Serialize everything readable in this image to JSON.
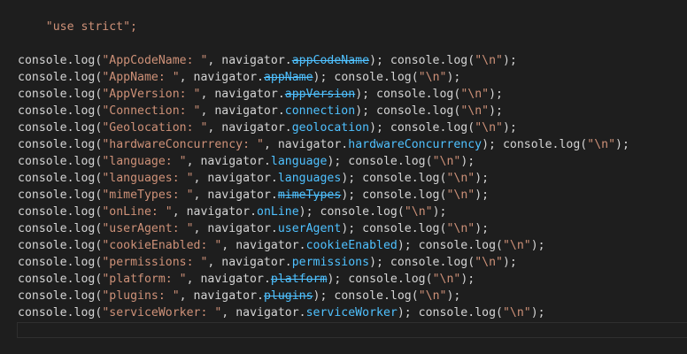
{
  "editor": {
    "theme_colors": {
      "background": "#1e1e1e",
      "string": "#ce9178",
      "identifier": "#d4d4d4",
      "property": "#4fc1ff"
    },
    "directive": "\"use strict\";",
    "lines": [
      {
        "obj": "console",
        "dot1": ".",
        "fn": "log",
        "open": "(",
        "label": "\"AppCodeName: \"",
        "comma": ", ",
        "target": "navigator",
        "dot2": ".",
        "prop": "appCodeName",
        "deprecated": true,
        "close": "); ",
        "obj2": "console",
        "dot3": ".",
        "fn2": "log",
        "open2": "(",
        "nl": "\"\\n\"",
        "close2": ");"
      },
      {
        "obj": "console",
        "dot1": ".",
        "fn": "log",
        "open": "(",
        "label": "\"AppName: \"",
        "comma": ", ",
        "target": "navigator",
        "dot2": ".",
        "prop": "appName",
        "deprecated": true,
        "close": "); ",
        "obj2": "console",
        "dot3": ".",
        "fn2": "log",
        "open2": "(",
        "nl": "\"\\n\"",
        "close2": ");"
      },
      {
        "obj": "console",
        "dot1": ".",
        "fn": "log",
        "open": "(",
        "label": "\"AppVersion: \"",
        "comma": ", ",
        "target": "navigator",
        "dot2": ".",
        "prop": "appVersion",
        "deprecated": true,
        "close": "); ",
        "obj2": "console",
        "dot3": ".",
        "fn2": "log",
        "open2": "(",
        "nl": "\"\\n\"",
        "close2": ");"
      },
      {
        "obj": "console",
        "dot1": ".",
        "fn": "log",
        "open": "(",
        "label": "\"Connection: \"",
        "comma": ", ",
        "target": "navigator",
        "dot2": ".",
        "prop": "connection",
        "deprecated": false,
        "close": "); ",
        "obj2": "console",
        "dot3": ".",
        "fn2": "log",
        "open2": "(",
        "nl": "\"\\n\"",
        "close2": ");"
      },
      {
        "obj": "console",
        "dot1": ".",
        "fn": "log",
        "open": "(",
        "label": "\"Geolocation: \"",
        "comma": ", ",
        "target": "navigator",
        "dot2": ".",
        "prop": "geolocation",
        "deprecated": false,
        "close": "); ",
        "obj2": "console",
        "dot3": ".",
        "fn2": "log",
        "open2": "(",
        "nl": "\"\\n\"",
        "close2": ");"
      },
      {
        "obj": "console",
        "dot1": ".",
        "fn": "log",
        "open": "(",
        "label": "\"hardwareConcurrency: \"",
        "comma": ", ",
        "target": "navigator",
        "dot2": ".",
        "prop": "hardwareConcurrency",
        "deprecated": false,
        "close": "); ",
        "obj2": "console",
        "dot3": ".",
        "fn2": "log",
        "open2": "(",
        "nl": "\"\\n\"",
        "close2": ");"
      },
      {
        "obj": "console",
        "dot1": ".",
        "fn": "log",
        "open": "(",
        "label": "\"language: \"",
        "comma": ", ",
        "target": "navigator",
        "dot2": ".",
        "prop": "language",
        "deprecated": false,
        "close": "); ",
        "obj2": "console",
        "dot3": ".",
        "fn2": "log",
        "open2": "(",
        "nl": "\"\\n\"",
        "close2": ");"
      },
      {
        "obj": "console",
        "dot1": ".",
        "fn": "log",
        "open": "(",
        "label": "\"languages: \"",
        "comma": ", ",
        "target": "navigator",
        "dot2": ".",
        "prop": "languages",
        "deprecated": false,
        "close": "); ",
        "obj2": "console",
        "dot3": ".",
        "fn2": "log",
        "open2": "(",
        "nl": "\"\\n\"",
        "close2": ");"
      },
      {
        "obj": "console",
        "dot1": ".",
        "fn": "log",
        "open": "(",
        "label": "\"mimeTypes: \"",
        "comma": ", ",
        "target": "navigator",
        "dot2": ".",
        "prop": "mimeTypes",
        "deprecated": true,
        "close": "); ",
        "obj2": "console",
        "dot3": ".",
        "fn2": "log",
        "open2": "(",
        "nl": "\"\\n\"",
        "close2": ");"
      },
      {
        "obj": "console",
        "dot1": ".",
        "fn": "log",
        "open": "(",
        "label": "\"onLine: \"",
        "comma": ", ",
        "target": "navigator",
        "dot2": ".",
        "prop": "onLine",
        "deprecated": false,
        "close": "); ",
        "obj2": "console",
        "dot3": ".",
        "fn2": "log",
        "open2": "(",
        "nl": "\"\\n\"",
        "close2": ");"
      },
      {
        "obj": "console",
        "dot1": ".",
        "fn": "log",
        "open": "(",
        "label": "\"userAgent: \"",
        "comma": ", ",
        "target": "navigator",
        "dot2": ".",
        "prop": "userAgent",
        "deprecated": false,
        "close": "); ",
        "obj2": "console",
        "dot3": ".",
        "fn2": "log",
        "open2": "(",
        "nl": "\"\\n\"",
        "close2": ");"
      },
      {
        "obj": "console",
        "dot1": ".",
        "fn": "log",
        "open": "(",
        "label": "\"cookieEnabled: \"",
        "comma": ", ",
        "target": "navigator",
        "dot2": ".",
        "prop": "cookieEnabled",
        "deprecated": false,
        "close": "); ",
        "obj2": "console",
        "dot3": ".",
        "fn2": "log",
        "open2": "(",
        "nl": "\"\\n\"",
        "close2": ");"
      },
      {
        "obj": "console",
        "dot1": ".",
        "fn": "log",
        "open": "(",
        "label": "\"permissions: \"",
        "comma": ", ",
        "target": "navigator",
        "dot2": ".",
        "prop": "permissions",
        "deprecated": false,
        "close": "); ",
        "obj2": "console",
        "dot3": ".",
        "fn2": "log",
        "open2": "(",
        "nl": "\"\\n\"",
        "close2": ");"
      },
      {
        "obj": "console",
        "dot1": ".",
        "fn": "log",
        "open": "(",
        "label": "\"platform: \"",
        "comma": ", ",
        "target": "navigator",
        "dot2": ".",
        "prop": "platform",
        "deprecated": true,
        "close": "); ",
        "obj2": "console",
        "dot3": ".",
        "fn2": "log",
        "open2": "(",
        "nl": "\"\\n\"",
        "close2": ");"
      },
      {
        "obj": "console",
        "dot1": ".",
        "fn": "log",
        "open": "(",
        "label": "\"plugins: \"",
        "comma": ", ",
        "target": "navigator",
        "dot2": ".",
        "prop": "plugins",
        "deprecated": true,
        "close": "); ",
        "obj2": "console",
        "dot3": ".",
        "fn2": "log",
        "open2": "(",
        "nl": "\"\\n\"",
        "close2": ");"
      },
      {
        "obj": "console",
        "dot1": ".",
        "fn": "log",
        "open": "(",
        "label": "\"serviceWorker: \"",
        "comma": ", ",
        "target": "navigator",
        "dot2": ".",
        "prop": "serviceWorker",
        "deprecated": false,
        "close": "); ",
        "obj2": "console",
        "dot3": ".",
        "fn2": "log",
        "open2": "(",
        "nl": "\"\\n\"",
        "close2": ");"
      }
    ]
  }
}
